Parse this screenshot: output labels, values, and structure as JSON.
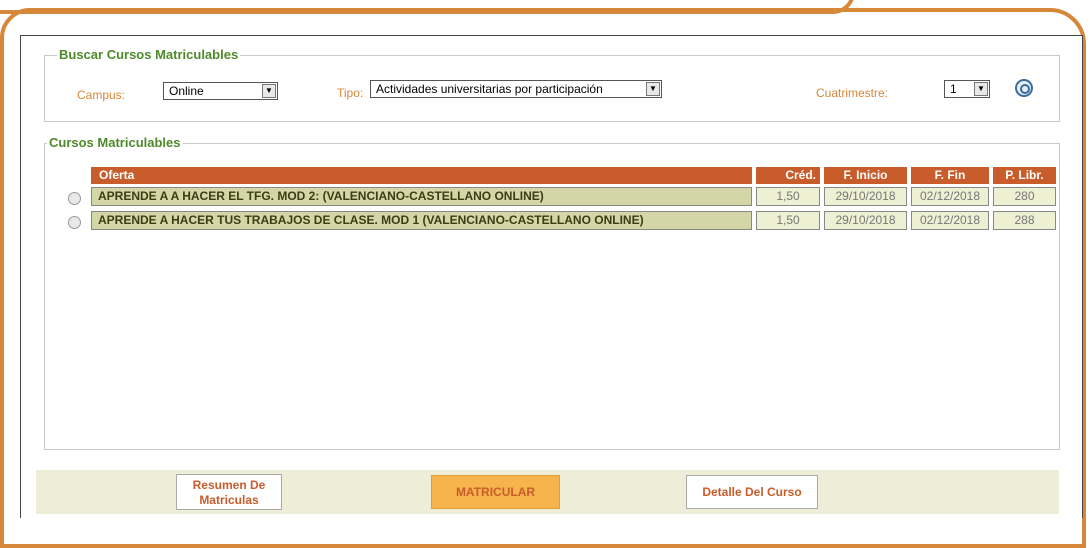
{
  "colors": {
    "frame": "#d7873a",
    "header": "#c85c2b",
    "legend": "#4f8a2b",
    "row": "#d3d7a7"
  },
  "search": {
    "legend": "Buscar Cursos Matriculables",
    "campus_label": "Campus:",
    "campus_value": "Online",
    "tipo_label": "Tipo:",
    "tipo_value": "Actividades universitarias por participación",
    "cuatrimestre_label": "Cuatrimestre:",
    "cuatrimestre_value": "1"
  },
  "courses": {
    "legend": "Cursos Matriculables",
    "headers": [
      "Oferta",
      "Créd.",
      "F. Inicio",
      "F. Fin",
      "P. Libr."
    ],
    "rows": [
      {
        "oferta": "APRENDE A A HACER EL TFG. MOD 2: (VALENCIANO-CASTELLANO ONLINE)",
        "cred": "1,50",
        "inicio": "29/10/2018",
        "fin": "02/12/2018",
        "libres": "280"
      },
      {
        "oferta": "APRENDE A HACER TUS TRABAJOS DE CLASE. MOD 1 (VALENCIANO-CASTELLANO ONLINE)",
        "cred": "1,50",
        "inicio": "29/10/2018",
        "fin": "02/12/2018",
        "libres": "288"
      }
    ]
  },
  "buttons": {
    "resumen_line1": "Resumen De",
    "resumen_line2": "Matriculas",
    "matricular": "MATRICULAR",
    "detalle": "Detalle Del Curso"
  }
}
